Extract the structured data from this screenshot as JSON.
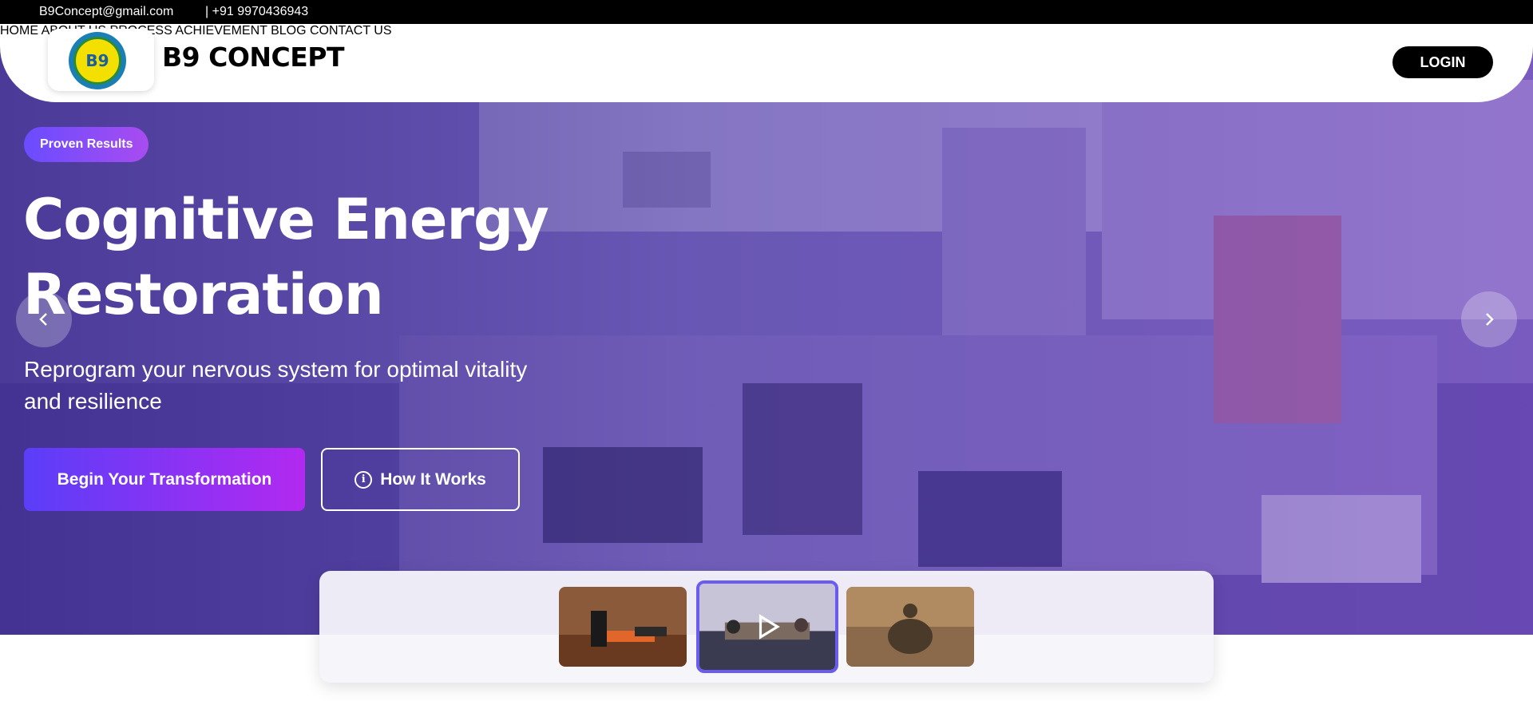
{
  "topbar": {
    "email": "B9Concept@gmail.com",
    "phone": "| +91 9970436943"
  },
  "nav": {
    "logo_text": "B9",
    "brand": "B9 CONCEPT",
    "menu": [
      "HOME",
      "ABOUT US",
      "PROCESS",
      "ACHIEVEMENT",
      "BLOG",
      "CONTACT US"
    ],
    "login": "LOGIN"
  },
  "hero": {
    "badge": "Proven Results",
    "title": "Cognitive Energy Restoration",
    "subtitle": "Reprogram your nervous system for optimal vitality and resilience",
    "primary_cta": "Begin Your Transformation",
    "secondary_cta": "How It Works",
    "info_icon": "info-icon",
    "prev_icon": "chevron-left-icon",
    "next_icon": "chevron-right-icon"
  },
  "thumbnails": [
    {
      "label": "fitness",
      "active": false
    },
    {
      "label": "meeting",
      "active": true,
      "icon": "play-icon"
    },
    {
      "label": "meditation",
      "active": false
    }
  ],
  "colors": {
    "accent_start": "#5b3ef8",
    "accent_end": "#b229f0",
    "overlay": "#4a3d8f"
  }
}
